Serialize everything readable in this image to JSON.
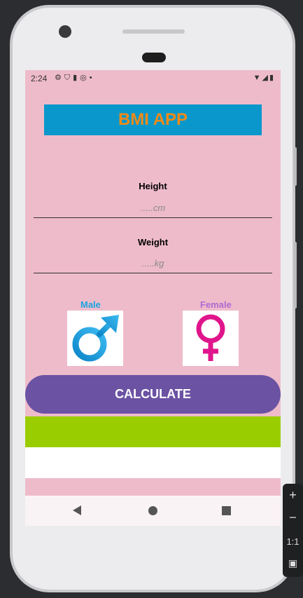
{
  "status_bar": {
    "time": "2:24"
  },
  "app": {
    "title": "BMI APP",
    "height_label": "Height",
    "height_placeholder": ".....cm",
    "weight_label": "Weight",
    "weight_placeholder": ".....kg",
    "male_label": "Male",
    "female_label": "Female",
    "calculate_label": "CALCULATE"
  },
  "colors": {
    "background": "#eebbcb",
    "title_bg": "#0a98cc",
    "title_text": "#f08a16",
    "male": "#1aa3e0",
    "female": "#e0158c",
    "button": "#6b52a3",
    "result_bar": "#9acd00"
  },
  "icons": {
    "male": "male-symbol-icon",
    "female": "female-symbol-icon"
  },
  "emulator_panel": {
    "zoom_label": "1:1"
  }
}
